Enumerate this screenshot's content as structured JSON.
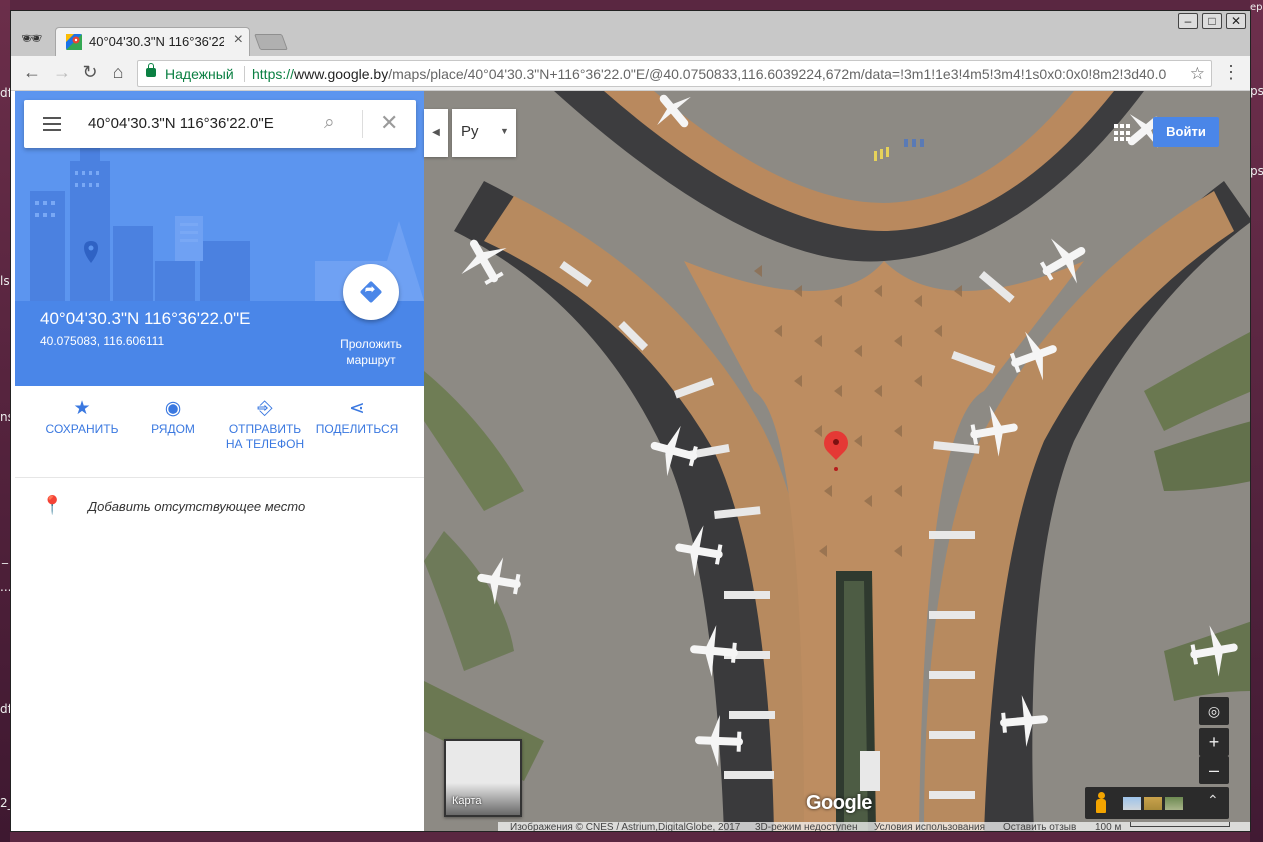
{
  "desktop": {
    "left_fragments": [
      "df",
      "ls",
      "ns",
      "_",
      "...",
      "df",
      "2_"
    ],
    "right_fragments": [
      "ерв",
      "ps",
      "ps"
    ]
  },
  "browser": {
    "tab_title": "40°04'30.3\"N 116°36'22.0\"E",
    "secure_label": "Надежный",
    "url_scheme": "https://",
    "url_host": "www.google.by",
    "url_path": "/maps/place/40°04'30.3\"N+116°36'22.0\"E/@40.0750833,116.6039224,672m/data=!3m1!1e3!4m5!3m4!1s0x0:0x0!8m2!3d40.0",
    "window_buttons": [
      "–",
      "□",
      "✕"
    ],
    "nav_icons": [
      "back-arrow",
      "forward-arrow",
      "reload",
      "home"
    ]
  },
  "sidebar": {
    "search_value": "40°04'30.3\"N 116°36'22.0\"E",
    "place_title": "40°04'30.3\"N 116°36'22.0\"E",
    "place_coords": "40.075083, 116.606111",
    "directions_label_1": "Проложить",
    "directions_label_2": "маршрут",
    "actions": [
      {
        "label_1": "Сохранить",
        "label_2": "",
        "icon": "star-icon"
      },
      {
        "label_1": "Рядом",
        "label_2": "",
        "icon": "nearby-icon"
      },
      {
        "label_1": "Отправить",
        "label_2": "на телефон",
        "icon": "send-to-phone-icon"
      },
      {
        "label_1": "Поделиться",
        "label_2": "",
        "icon": "share-icon"
      }
    ],
    "add_missing_place": "Добавить отсутствующее место"
  },
  "map": {
    "language": "Ру",
    "login_label": "Войти",
    "minimap_label": "Карта",
    "logo": "Google",
    "footer": {
      "imagery": "Изображения © CNES / Astrium,DigitalGlobe, 2017",
      "three_d": "3D-режим недоступен",
      "terms": "Условия использования",
      "feedback": "Оставить отзыв",
      "scale": "100 м"
    },
    "zoom_in": "+",
    "zoom_out": "–",
    "colors": {
      "accent": "#4a86e8",
      "pin": "#e53935",
      "terminal": "#b6875c"
    }
  }
}
